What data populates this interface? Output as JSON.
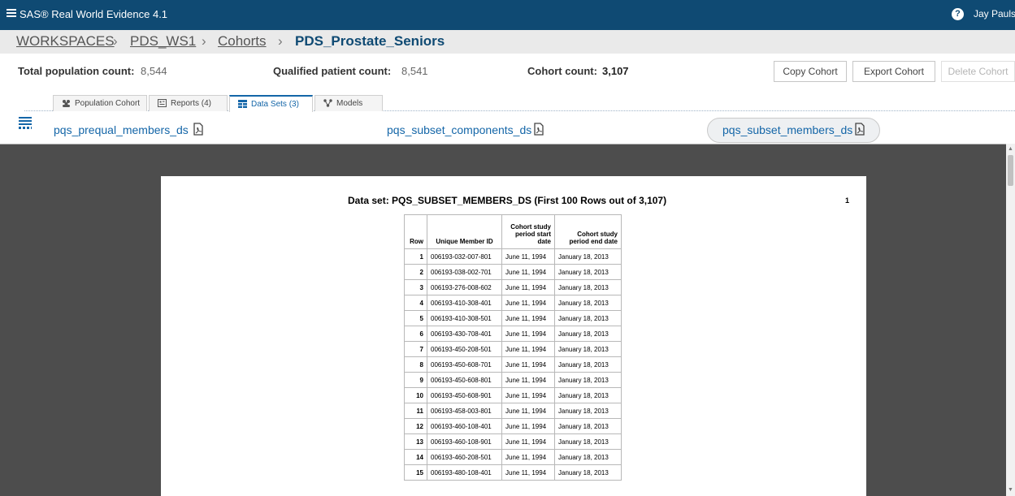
{
  "app": {
    "title": "SAS® Real World Evidence 4.1",
    "user": "Jay Paulso",
    "help_glyph": "?"
  },
  "breadcrumb": {
    "items": [
      "WORKSPACES",
      "PDS_WS1",
      "Cohorts"
    ],
    "separator": "›",
    "current": "PDS_Prostate_Seniors"
  },
  "counts": {
    "total_population": {
      "label": "Total population count:",
      "value": "8,544"
    },
    "qualified_patient": {
      "label": "Qualified patient count:",
      "value": "8,541"
    },
    "cohort": {
      "label": "Cohort count:",
      "value": "3,107"
    }
  },
  "actions": {
    "copy_cohort": "Copy Cohort",
    "export_cohort": "Export Cohort",
    "delete_cohort": "Delete Cohort"
  },
  "tabs": [
    {
      "label": "Population Cohort",
      "icon": "people-icon",
      "active": false
    },
    {
      "label": "Reports (4)",
      "icon": "report-icon",
      "active": false
    },
    {
      "label": "Data Sets (3)",
      "icon": "dataset-icon",
      "active": true
    },
    {
      "label": "Models",
      "icon": "model-icon",
      "active": false
    }
  ],
  "datasets": [
    {
      "name": "pqs_prequal_members_ds",
      "icon": "pdf-icon"
    },
    {
      "name": "pqs_subset_components_ds",
      "icon": "pdf-icon"
    },
    {
      "name": "pqs_subset_members_ds",
      "icon": "pdf-icon",
      "selected": true
    }
  ],
  "report": {
    "title": "Data set: PQS_SUBSET_MEMBERS_DS (First 100 Rows out of 3,107)",
    "page_number": "1",
    "columns": [
      {
        "label": "Row"
      },
      {
        "label": "Unique Member ID"
      },
      {
        "label": [
          "Cohort study",
          "period start",
          "date"
        ]
      },
      {
        "label": [
          "Cohort study",
          "period end date"
        ]
      }
    ],
    "rows": [
      [
        "1",
        "006193-032-007-801",
        "June 11, 1994",
        "January 18, 2013"
      ],
      [
        "2",
        "006193-038-002-701",
        "June 11, 1994",
        "January 18, 2013"
      ],
      [
        "3",
        "006193-276-008-602",
        "June 11, 1994",
        "January 18, 2013"
      ],
      [
        "4",
        "006193-410-308-401",
        "June 11, 1994",
        "January 18, 2013"
      ],
      [
        "5",
        "006193-410-308-501",
        "June 11, 1994",
        "January 18, 2013"
      ],
      [
        "6",
        "006193-430-708-401",
        "June 11, 1994",
        "January 18, 2013"
      ],
      [
        "7",
        "006193-450-208-501",
        "June 11, 1994",
        "January 18, 2013"
      ],
      [
        "8",
        "006193-450-608-701",
        "June 11, 1994",
        "January 18, 2013"
      ],
      [
        "9",
        "006193-450-608-801",
        "June 11, 1994",
        "January 18, 2013"
      ],
      [
        "10",
        "006193-450-608-901",
        "June 11, 1994",
        "January 18, 2013"
      ],
      [
        "11",
        "006193-458-003-801",
        "June 11, 1994",
        "January 18, 2013"
      ],
      [
        "12",
        "006193-460-108-401",
        "June 11, 1994",
        "January 18, 2013"
      ],
      [
        "13",
        "006193-460-108-901",
        "June 11, 1994",
        "January 18, 2013"
      ],
      [
        "14",
        "006193-460-208-501",
        "June 11, 1994",
        "January 18, 2013"
      ],
      [
        "15",
        "006193-480-108-401",
        "June 11, 1994",
        "January 18, 2013"
      ]
    ]
  },
  "colors": {
    "topbar": "#0f4a73",
    "link": "#1466a8",
    "breadcrumb_bg": "#eaeaea",
    "viewer_bg": "#4d4d4d"
  }
}
